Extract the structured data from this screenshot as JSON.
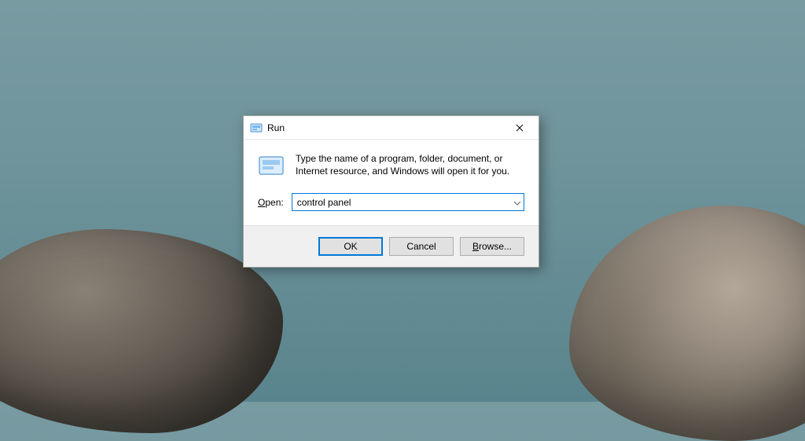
{
  "dialog": {
    "title": "Run",
    "description": "Type the name of a program, folder, document, or Internet resource, and Windows will open it for you.",
    "open_label_pre": "O",
    "open_label_post": "pen:",
    "open_value": "control panel",
    "buttons": {
      "ok": "OK",
      "cancel": "Cancel",
      "browse_pre": "B",
      "browse_post": "rowse..."
    }
  }
}
